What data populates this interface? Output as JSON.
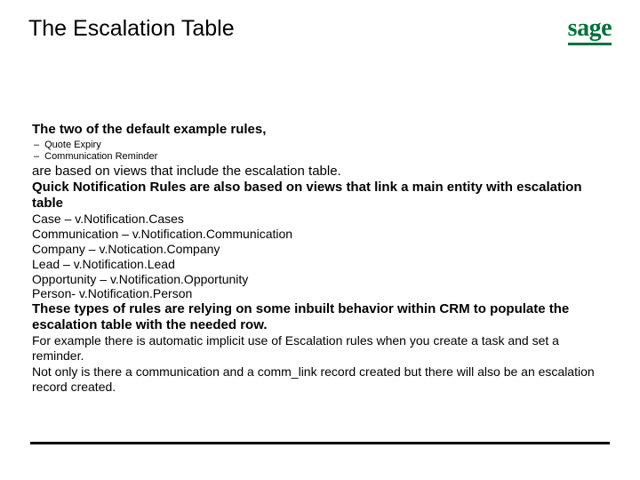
{
  "header": {
    "title": "The Escalation Table",
    "logo_text": "sage"
  },
  "content": {
    "intro_heading": "The two of the default example rules,",
    "bullets": {
      "b0": "Quote Expiry",
      "b1": "Communication Reminder"
    },
    "line_after_bullets": "are based on views that include the escalation table.",
    "quick_rules_heading": "Quick Notification Rules are also based on views that link a main entity with escalation table",
    "mappings": {
      "m0": "Case – v.Notification.Cases",
      "m1": "Communication – v.Notification.Communication",
      "m2": "Company – v.Notication.Company",
      "m3": "Lead – v.Notification.Lead",
      "m4": "Opportunity – v.Notification.Opportunity",
      "m5": "Person- v.Notification.Person"
    },
    "rely_heading": "These types of rules are relying on some inbuilt behavior within CRM to populate the escalation table with the needed row.",
    "para1": "For example there is automatic implicit use of Escalation rules when you create a task and set a reminder.",
    "para2": "Not only is there a communication and a comm_link record created but there will also be an escalation record created."
  }
}
